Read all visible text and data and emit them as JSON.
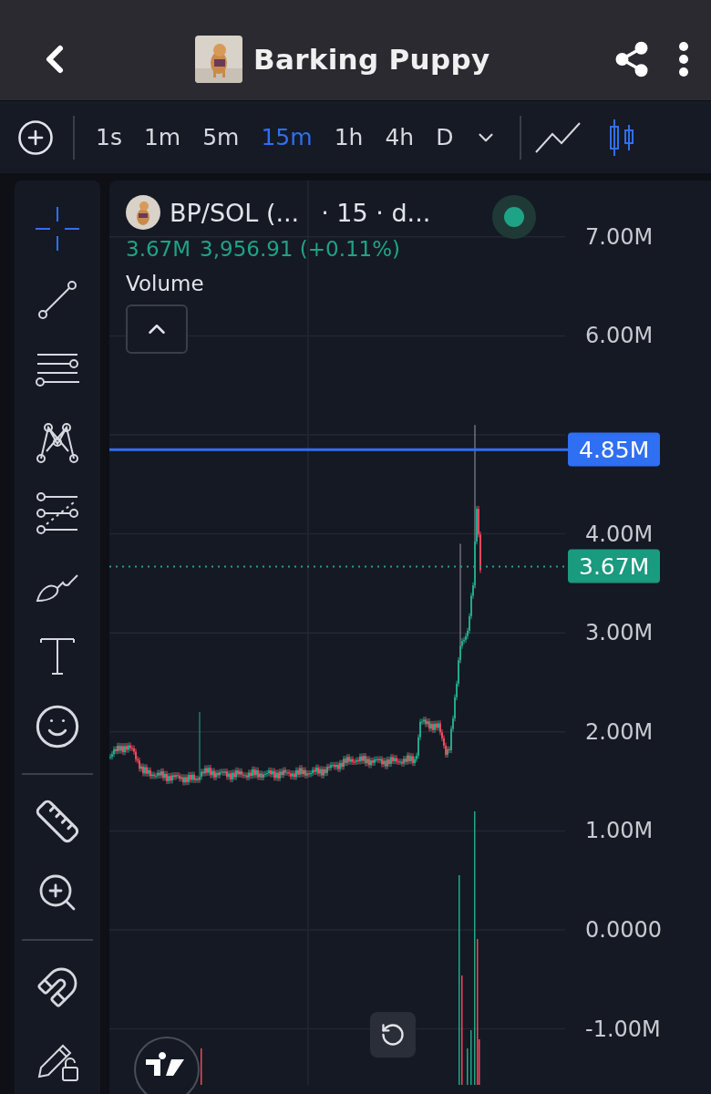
{
  "header": {
    "title": "Barking Puppy"
  },
  "toolbar": {
    "intervals": [
      {
        "label": "1s",
        "selected": false
      },
      {
        "label": "1m",
        "selected": false
      },
      {
        "label": "5m",
        "selected": false
      },
      {
        "label": "15m",
        "selected": true
      },
      {
        "label": "1h",
        "selected": false
      },
      {
        "label": "4h",
        "selected": false
      },
      {
        "label": "D",
        "selected": false
      }
    ],
    "chart_types": [
      {
        "kind": "line",
        "selected": false
      },
      {
        "kind": "candles",
        "selected": true
      }
    ]
  },
  "tool_groups": [
    {
      "tools": [
        {
          "kind": "crosshair",
          "selected": true
        },
        {
          "kind": "trend-line",
          "selected": false
        },
        {
          "kind": "parallel-lines",
          "selected": false
        },
        {
          "kind": "pattern",
          "selected": false
        },
        {
          "kind": "fib",
          "selected": false
        },
        {
          "kind": "brush",
          "selected": false
        },
        {
          "kind": "text",
          "selected": false
        },
        {
          "kind": "emoji",
          "selected": false
        }
      ]
    },
    {
      "tools": [
        {
          "kind": "ruler",
          "selected": false
        },
        {
          "kind": "zoom",
          "selected": false
        }
      ]
    },
    {
      "tools": [
        {
          "kind": "magnet",
          "selected": false
        },
        {
          "kind": "lock",
          "selected": false
        }
      ]
    }
  ],
  "legend": {
    "symbol": "BP/SOL (...",
    "details": "· 15 · d...",
    "live": true,
    "last": "3.67M",
    "change": "3,956.91 (+0.11%)",
    "indicator": "Volume"
  },
  "y_axis": [
    "7.00M",
    "6.00M",
    "4.00M",
    "3.00M",
    "2.00M",
    "1.00M",
    "0.0000",
    "-1.00M"
  ],
  "price_line": {
    "label": "4.85M"
  },
  "last_price": {
    "label": "3.67M"
  }
}
